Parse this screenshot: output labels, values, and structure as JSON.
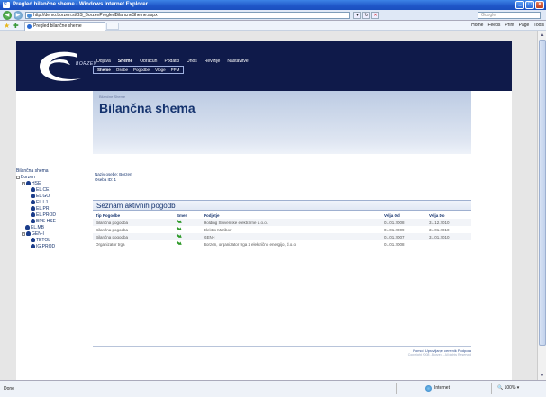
{
  "window": {
    "title": "Pregled bilančne sheme - Windows Internet Explorer",
    "url": "http://demo.borzen.si/BS_BorzenPregledBilancneSheme.aspx",
    "search_placeholder": "Google",
    "tab_label": "Pregled bilančne sheme",
    "commands": [
      "Home",
      "Feeds",
      "Print",
      "Page",
      "Tools"
    ],
    "status_done": "Done",
    "status_zone": "Internet",
    "status_zoom": "100%"
  },
  "site": {
    "logo_text": "BORZEN",
    "main_menu": [
      "Odjava",
      "Sheme",
      "Obračun",
      "Podatki",
      "Unos",
      "Revizije",
      "Nastavitve"
    ],
    "main_menu_active": "Sheme",
    "sub_menu": [
      "Sheme",
      "Osebe",
      "Pogodbe",
      "Vloge",
      "PPM"
    ],
    "sub_menu_active": "Sheme",
    "breadcrumb": "Bilančne Sheme",
    "page_title": "Bilančna shema"
  },
  "tree": {
    "title": "Bilančna shema",
    "nodes": [
      {
        "label": "Borzen",
        "level": 0,
        "expander": "-",
        "icon": false
      },
      {
        "label": "HSE",
        "level": 1,
        "expander": "-",
        "icon": true
      },
      {
        "label": "EL.CE",
        "level": 2,
        "expander": "",
        "icon": true
      },
      {
        "label": "EL.GO",
        "level": 2,
        "expander": "",
        "icon": true
      },
      {
        "label": "EL.LJ",
        "level": 2,
        "expander": "",
        "icon": true
      },
      {
        "label": "EL.PR",
        "level": 2,
        "expander": "",
        "icon": true
      },
      {
        "label": "EL.PROD",
        "level": 2,
        "expander": "",
        "icon": true
      },
      {
        "label": "BPS-HSE",
        "level": 2,
        "expander": "",
        "icon": true
      },
      {
        "label": "EL.MB",
        "level": 1,
        "expander": "",
        "icon": true
      },
      {
        "label": "GEN-I",
        "level": 1,
        "expander": "-",
        "icon": true
      },
      {
        "label": "TETOL",
        "level": 2,
        "expander": "",
        "icon": true
      },
      {
        "label": "IG.PROD",
        "level": 2,
        "expander": "",
        "icon": true
      }
    ]
  },
  "info": {
    "name_line": "Naziv osebe: Borzen",
    "id_line": "Oseba ID: 1"
  },
  "contracts": {
    "title": "Seznam aktivnih pogodb",
    "columns": [
      "Tip Pogodbe",
      "Smer",
      "Podjetje",
      "Velja Od",
      "Velja Do"
    ],
    "rows": [
      {
        "tip": "Bilančna pogodba",
        "podjetje": "Holding Slovenske elektrarne d.o.o.",
        "od": "01.01.2008",
        "do": "31.12.2010"
      },
      {
        "tip": "Bilančna pogodba",
        "podjetje": "Elektro Maribor",
        "od": "01.01.2009",
        "do": "31.01.2010"
      },
      {
        "tip": "Bilančna pogodba",
        "podjetje": "GEN-I",
        "od": "01.01.2007",
        "do": "31.01.2010"
      },
      {
        "tip": "Organizator trga",
        "podjetje": "Borzen, organizator trga z električno energijo, d.o.o.",
        "od": "01.01.2008",
        "do": ""
      }
    ]
  },
  "footer": {
    "links": "Pomoč  Upravljanje cenenik  Podpora",
    "copyright": "Copyright 2008 - Borzen - All rights Reserved"
  }
}
